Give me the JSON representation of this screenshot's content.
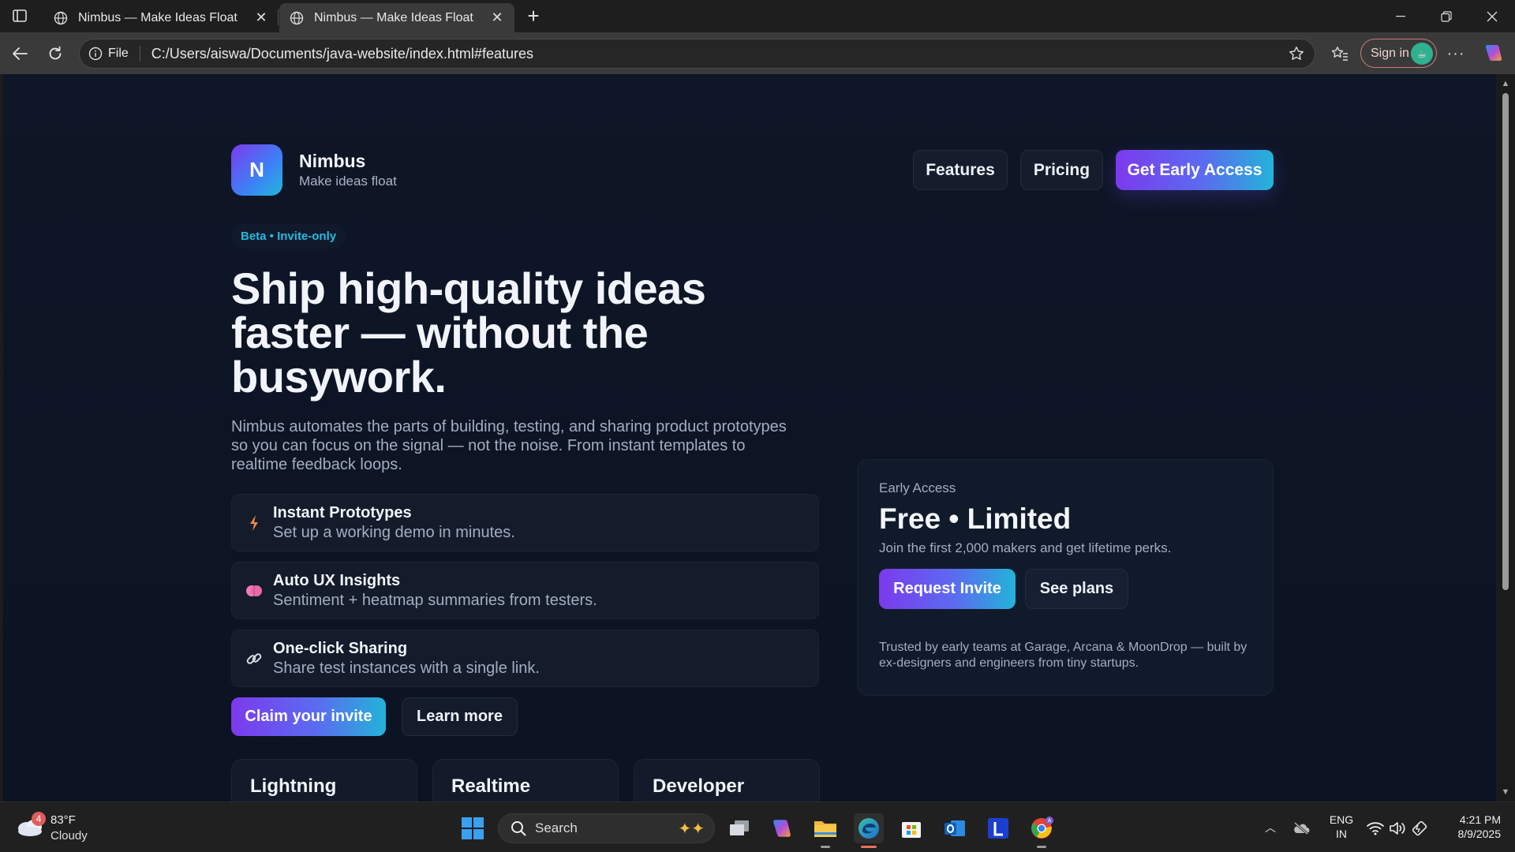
{
  "browser": {
    "tabs": [
      {
        "title": "Nimbus — Make Ideas Float"
      },
      {
        "title": "Nimbus — Make Ideas Float"
      }
    ],
    "new_tab_glyph": "+",
    "address": {
      "scheme_label": "File",
      "url": "C:/Users/aiswa/Documents/java-website/index.html#features"
    },
    "sign_in_label": "Sign in",
    "more_glyph": "···"
  },
  "site": {
    "logo_letter": "N",
    "brand_name": "Nimbus",
    "tagline": "Make ideas float",
    "nav": {
      "features": "Features",
      "pricing": "Pricing",
      "cta": "Get Early Access"
    },
    "badge": "Beta • Invite-only",
    "headline": "Ship high-quality ideas faster — without the busywork.",
    "lede": "Nimbus automates the parts of building, testing, and sharing product prototypes so you can focus on the signal — not the noise. From instant templates to realtime feedback loops.",
    "features": [
      {
        "title": "Instant Prototypes",
        "desc": "Set up a working demo in minutes.",
        "icon": "lightning-icon"
      },
      {
        "title": "Auto UX Insights",
        "desc": "Sentiment + heatmap summaries from testers.",
        "icon": "brain-icon"
      },
      {
        "title": "One-click Sharing",
        "desc": "Share test instances with a single link.",
        "icon": "link-icon"
      }
    ],
    "buttons": {
      "claim": "Claim your invite",
      "learn": "Learn more"
    },
    "stats": [
      "Lightning",
      "Realtime",
      "Developer"
    ],
    "card": {
      "eyebrow": "Early Access",
      "headline": "Free • Limited",
      "subtext": "Join the first 2,000 makers and get lifetime perks.",
      "primary": "Request Invite",
      "secondary": "See plans",
      "trust": "Trusted by early teams at Garage, Arcana & MoonDrop — built by ex-designers and engineers from tiny startups."
    },
    "colors": {
      "background": "#0e1627",
      "accent_start": "#7c3aed",
      "accent_end": "#23b3d9",
      "badge_text": "#27b9e0"
    }
  },
  "taskbar": {
    "weather": {
      "badge": "4",
      "temp": "83°F",
      "condition": "Cloudy"
    },
    "search_placeholder": "Search",
    "language": {
      "line1": "ENG",
      "line2": "IN"
    },
    "clock": {
      "time": "4:21 PM",
      "date": "8/9/2025"
    }
  }
}
